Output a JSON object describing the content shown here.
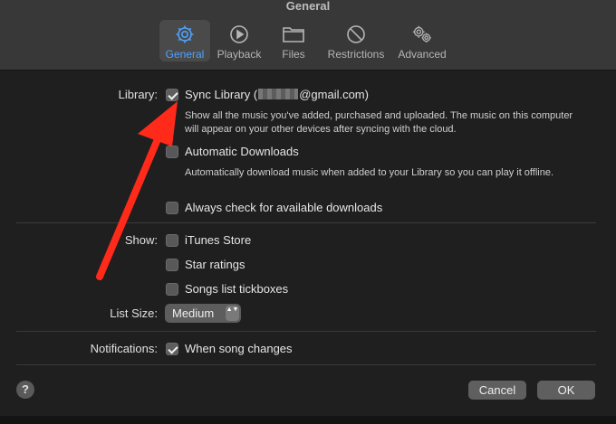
{
  "window": {
    "title": "General"
  },
  "tabs": [
    {
      "label": "General",
      "icon": "gear-icon",
      "active": true
    },
    {
      "label": "Playback",
      "icon": "play-icon",
      "active": false
    },
    {
      "label": "Files",
      "icon": "folder-icon",
      "active": false
    },
    {
      "label": "Restrictions",
      "icon": "restriction-icon",
      "active": false
    },
    {
      "label": "Advanced",
      "icon": "gears-icon",
      "active": false
    }
  ],
  "library": {
    "section_label": "Library:",
    "sync_label_prefix": "Sync Library (",
    "sync_label_suffix": "@gmail.com)",
    "sync_checked": true,
    "sync_desc": "Show all the music you've added, purchased and uploaded. The music on this computer will appear on your other devices after syncing with the cloud.",
    "auto_download_label": "Automatic Downloads",
    "auto_download_checked": false,
    "auto_download_desc": "Automatically download music when added to your Library so you can play it offline.",
    "always_check_label": "Always check for available downloads",
    "always_check_checked": false
  },
  "show": {
    "section_label": "Show:",
    "itunes_store_label": "iTunes Store",
    "star_ratings_label": "Star ratings",
    "tickboxes_label": "Songs list tickboxes"
  },
  "list_size": {
    "label": "List Size:",
    "value": "Medium",
    "arrows": "▲▼"
  },
  "notifications": {
    "label": "Notifications:",
    "song_changes_label": "When song changes",
    "checked": true
  },
  "buttons": {
    "help": "?",
    "cancel": "Cancel",
    "ok": "OK"
  },
  "colors": {
    "accent": "#4ea3ff",
    "annotation_arrow": "#ff2a1a"
  }
}
